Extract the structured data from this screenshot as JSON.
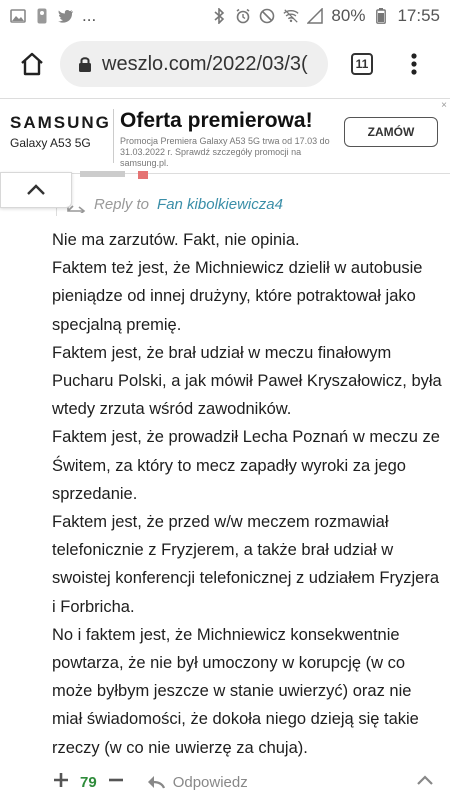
{
  "status_bar": {
    "left_icons": [
      "image-icon",
      "nba-icon",
      "twitter-icon",
      "more-icon"
    ],
    "more_text": "...",
    "battery": "80%",
    "time": "17:55"
  },
  "browser": {
    "url": "weszlo.com/2022/03/3(",
    "tab_count": "11"
  },
  "ad": {
    "brand": "SAMSUNG",
    "model": "Galaxy A53 5G",
    "title": "Oferta premierowa!",
    "subtitle": "Promocja Premiera Galaxy A53 5G trwa od 17.03 do 31.03.2022 r. Sprawdź szczegóły promocji na samsung.pl.",
    "cta": "ZAMÓW",
    "close": "×"
  },
  "comment": {
    "reply_to_label": "Reply to",
    "reply_to_name": "Fan kibolkiewicza4",
    "paragraphs": [
      "Nie ma zarzutów. Fakt, nie opinia.",
      "Faktem też jest, że Michniewicz dzielił w autobusie pieniądze od innej drużyny, które potraktował jako specjalną premię.",
      "Faktem jest, że brał udział w meczu finałowym Pucharu Polski, a jak mówił Paweł Kryszałowicz, była wtedy zrzuta wśród zawodników.",
      "Faktem jest, że prowadził Lecha Poznań w meczu ze Świtem, za który to mecz zapadły wyroki za jego sprzedanie.",
      "Faktem jest, że przed w/w meczem rozmawiał telefonicznie z Fryzjerem, a także brał udział w swoistej konferencji telefonicznej z udziałem Fryzjera i Forbricha.",
      "No i faktem jest, że Michniewicz konsekwentnie powtarza, że nie był umoczony w korupcję (w co może byłbym jeszcze w stanie uwierzyć) oraz nie miał świadomości, że dokoła niego dzieją się takie rzeczy (w co nie uwierzę za chuja)."
    ],
    "votes": "79",
    "reply_label": "Odpowiedz"
  },
  "colors": {
    "link": "#3a8ea8",
    "vote_positive": "#2e8b3a",
    "muted": "#999999"
  }
}
